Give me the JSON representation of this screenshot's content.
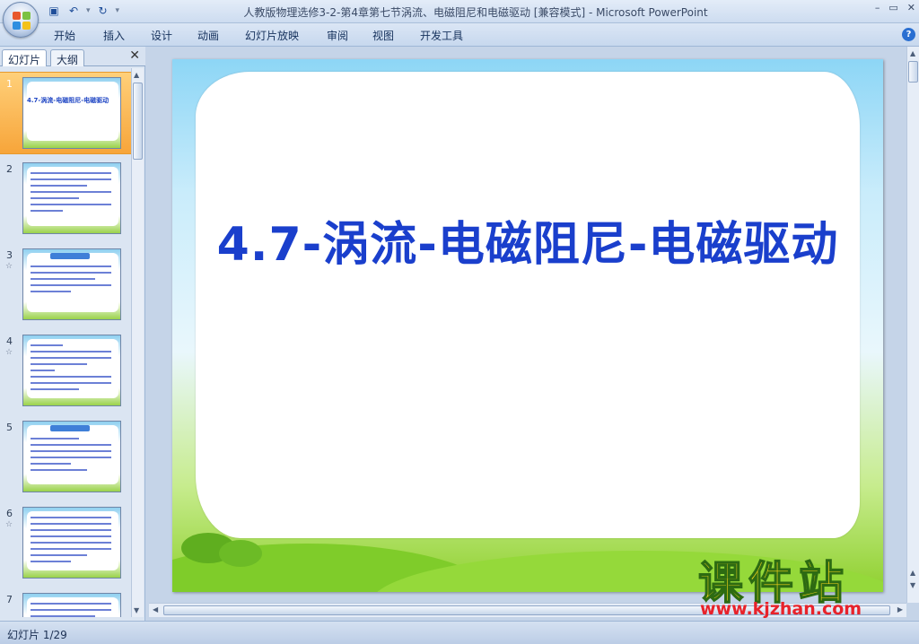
{
  "window": {
    "title": "人教版物理选修3-2-第4章第七节涡流、电磁阻尼和电磁驱动 [兼容模式] - Microsoft PowerPoint"
  },
  "ribbon": {
    "tabs": [
      "开始",
      "插入",
      "设计",
      "动画",
      "幻灯片放映",
      "审阅",
      "视图",
      "开发工具"
    ]
  },
  "left_pane": {
    "tabs": [
      "幻灯片",
      "大纲"
    ],
    "thumbnails": [
      {
        "num": "1",
        "title": "4.7-涡流-电磁阻尼-电磁驱动",
        "selected": true,
        "star": false
      },
      {
        "num": "2",
        "selected": false,
        "star": false
      },
      {
        "num": "3",
        "selected": false,
        "star": true
      },
      {
        "num": "4",
        "selected": false,
        "star": true
      },
      {
        "num": "5",
        "selected": false,
        "star": false
      },
      {
        "num": "6",
        "selected": false,
        "star": true
      },
      {
        "num": "7",
        "selected": false,
        "star": false
      }
    ]
  },
  "slide": {
    "title": "4.7-涡流-电磁阻尼-电磁驱动"
  },
  "status": {
    "slide_counter": "幻灯片 1/29"
  },
  "watermark": {
    "brand": "课件站",
    "url": "www.kjzhan.com"
  },
  "colors": {
    "slide_title": "#1a3fcc",
    "selection": "#f7a53a"
  }
}
